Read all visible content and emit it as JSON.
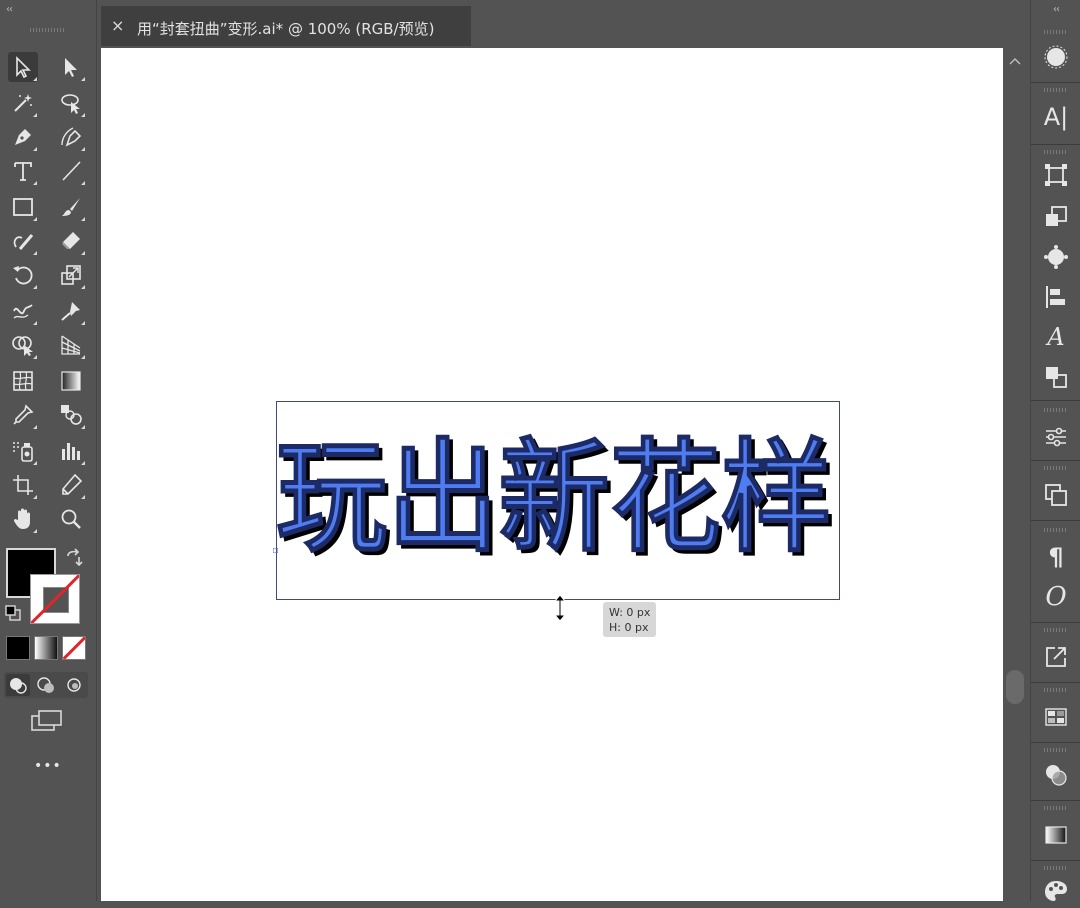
{
  "left_panel": {
    "collapse_glyph": "‹‹"
  },
  "document": {
    "close_glyph": "×",
    "tab_title": "用“封套扭曲”变形.ai* @ 100% (RGB/预览)"
  },
  "artwork": {
    "text": "玩出新花样",
    "fill_color": "#4f7cf0",
    "shadow_color": "#000000"
  },
  "tooltip": {
    "width_label": "W: 0 px",
    "height_label": "H: 0 px"
  },
  "toolbar": {
    "more_glyph": "•••"
  },
  "right_panel": {
    "collapse_glyph": "‹‹",
    "character_glyph": "A|",
    "opentype_glyph": "𝐴",
    "paragraph_glyph": "¶",
    "glyphs_glyph": "O"
  },
  "colors": {
    "fill": "#000000",
    "stroke_none": "#e0262b",
    "ui_bg": "#535353",
    "canvas": "#ffffff"
  }
}
